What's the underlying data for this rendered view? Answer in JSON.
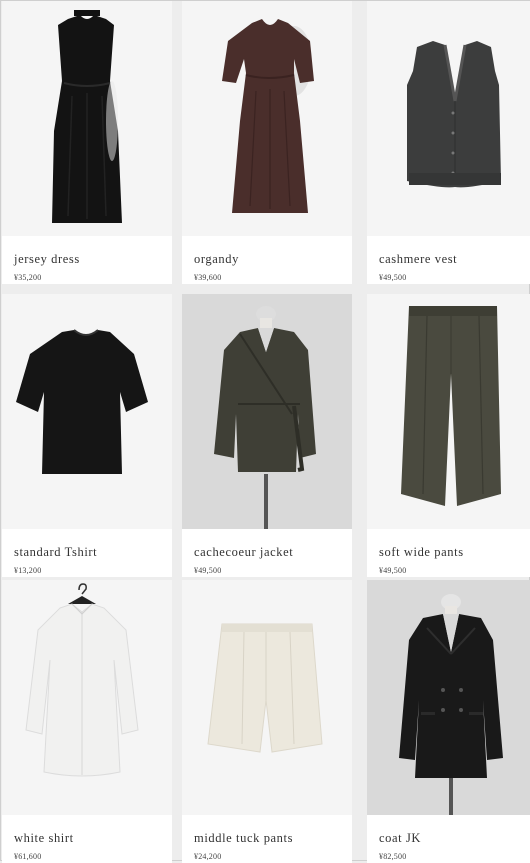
{
  "products": [
    {
      "name": "jersey dress",
      "price": "¥35,200",
      "image": "black-sleeveless-jersey-dress"
    },
    {
      "name": "organdy",
      "price": "¥39,600",
      "image": "brown-organdy-dress"
    },
    {
      "name": "cashmere vest",
      "price": "¥49,500",
      "image": "charcoal-cashmere-vest"
    },
    {
      "name": "standard Tshirt",
      "price": "¥13,200",
      "image": "black-tshirt"
    },
    {
      "name": "cachecoeur jacket",
      "price": "¥49,500",
      "image": "olive-wrap-jacket"
    },
    {
      "name": "soft wide pants",
      "price": "¥49,500",
      "image": "olive-wide-pants"
    },
    {
      "name": "white shirt",
      "price": "¥61,600",
      "image": "white-shirt"
    },
    {
      "name": "middle tuck pants",
      "price": "¥24,200",
      "image": "cream-shorts"
    },
    {
      "name": "coat JK",
      "price": "¥82,500",
      "image": "black-double-breasted-coat"
    }
  ]
}
